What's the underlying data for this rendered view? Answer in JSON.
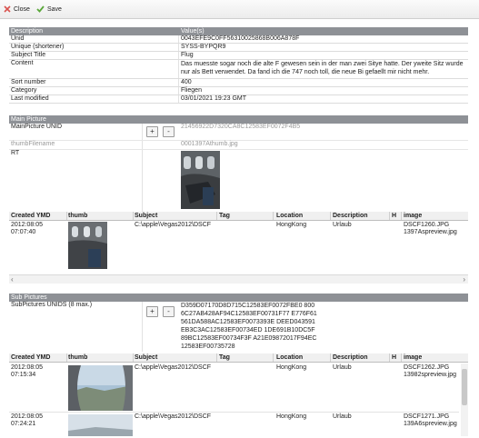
{
  "toolbar": {
    "close_label": "Close",
    "save_label": "Save"
  },
  "description_table": {
    "header_col1": "Description",
    "header_col2": "Value(s)",
    "rows": [
      {
        "label": "Unid",
        "value": "0043EFE9C0FF56310025868B006A878F"
      },
      {
        "label": "Unique (shortener)",
        "value": "SYSS-BYPQR9"
      },
      {
        "label": "Subject Title",
        "value": "Flug"
      },
      {
        "label": "Content",
        "value": "Das muesste sogar noch die alte F gewesen sein in der man zwei Sitye hatte. Der yweite Sitz wurde nur als Bett verwendet. Da fand ich die 747 noch toll, die neue Bi gefaellt mir nicht mehr."
      },
      {
        "label": "Sort number",
        "value": "400"
      },
      {
        "label": "Category",
        "value": "Fliegen"
      },
      {
        "label": "Last modified",
        "value": "03/01/2021 19:23 GMT"
      }
    ]
  },
  "main_picture": {
    "header": "Main Picture",
    "unid_label": "MainPicture UNID",
    "plus": "+",
    "minus": "-",
    "unid_value": "21456922D7320CA8C12583EF0072F4B5",
    "thumb_label": "thumbFilename",
    "thumb_value": "0001397Athumb.jpg",
    "rt_label": "RT",
    "grid": {
      "columns": [
        "Created YMD",
        "thumb",
        "Subject",
        "Tag",
        "Location",
        "Description",
        "H",
        "image"
      ],
      "rows": [
        {
          "created": "2012:08:05 07:07:40",
          "subject": "C:\\apple\\Vegas2012\\DSCF",
          "tag": "",
          "location": "HongKong",
          "description": "Urlaub",
          "h": "",
          "image": "DSCF1260.JPG 1397Aspreview.jpg"
        }
      ]
    },
    "scroll_left": "‹",
    "scroll_right": "›"
  },
  "sub_pictures": {
    "header": "Sub Pictures",
    "unids_label": "SubPictures UNIDS (8 max.)",
    "plus": "+",
    "minus": "-",
    "unids_value": "D359D07170D8D715C12583EF0072FBE0 8006C27AB428AF94C12583EF00731F77 E776F61561DA588AC12583EF0073393E DEED043591EB3C3AC12583EF00734ED 1DE691B10DC5F89BC12583EF00734F3F A21E09872017F94EC12583EF00735728",
    "grid": {
      "columns": [
        "Created YMD",
        "thumb",
        "Subject",
        "Tag",
        "Location",
        "Description",
        "H",
        "image"
      ],
      "rows": [
        {
          "created": "2012:08:05 07:15:34",
          "subject": "C:\\apple\\Vegas2012\\DSCF",
          "tag": "",
          "location": "HongKong",
          "description": "Urlaub",
          "h": "",
          "image": "DSCF1262.JPG 13982spreview.jpg"
        },
        {
          "created": "2012:08:05 07:24:21",
          "subject": "C:\\apple\\Vegas2012\\DSCF",
          "tag": "",
          "location": "HongKong",
          "description": "Urlaub",
          "h": "",
          "image": "DSCF1271.JPG 139A6spreview.jpg"
        }
      ]
    }
  },
  "colors": {
    "header_bg": "#8e9196",
    "accent_save": "#5aa83a",
    "close_icon": "#d9534f"
  }
}
